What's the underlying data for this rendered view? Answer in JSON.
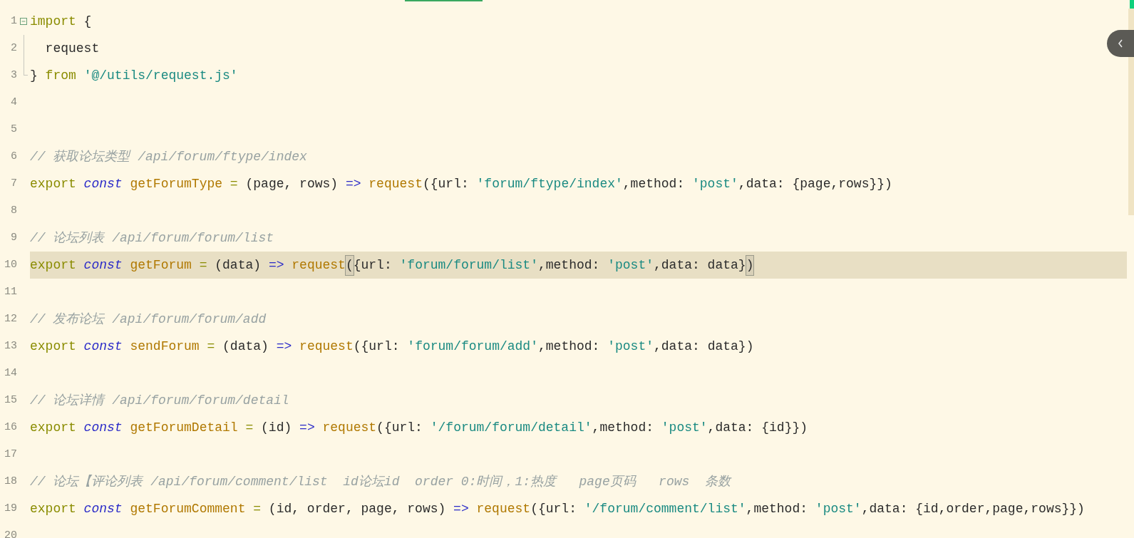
{
  "editor": {
    "lines": [
      {
        "number": "1",
        "kind": "fold_start",
        "current": false,
        "tokens": [
          {
            "kind": "keyword",
            "text": "import"
          },
          {
            "kind": "plain",
            "text": " {"
          }
        ]
      },
      {
        "number": "2",
        "kind": "fold_body",
        "current": false,
        "tokens": [
          {
            "kind": "plain",
            "text": "  request"
          }
        ]
      },
      {
        "number": "3",
        "kind": "fold_end",
        "current": false,
        "tokens": [
          {
            "kind": "plain",
            "text": "}"
          },
          {
            "kind": "keyword",
            "text": " from"
          },
          {
            "kind": "string",
            "text": " '@/utils/request.js'"
          }
        ]
      },
      {
        "number": "4",
        "kind": "code",
        "current": false
      },
      {
        "number": "5",
        "kind": "code",
        "current": false
      },
      {
        "number": "6",
        "kind": "code",
        "current": false,
        "tokens": [
          {
            "kind": "comment",
            "text": "// 获取论坛类型 /api/forum/ftype/index"
          }
        ]
      },
      {
        "number": "7",
        "kind": "code",
        "current": false,
        "tokens": [
          {
            "kind": "keyword",
            "text": "export"
          },
          {
            "kind": "storage",
            "text": " const"
          },
          {
            "kind": "function",
            "text": " getForumType"
          },
          {
            "kind": "keyword",
            "text": " ="
          },
          {
            "kind": "plain",
            "text": " (page, rows)"
          },
          {
            "kind": "arrow",
            "text": " =>"
          },
          {
            "kind": "function",
            "text": " request"
          },
          {
            "kind": "plain",
            "text": "({url: "
          },
          {
            "kind": "string",
            "text": "'forum/ftype/index'"
          },
          {
            "kind": "plain",
            "text": ",method: "
          },
          {
            "kind": "string",
            "text": "'post'"
          },
          {
            "kind": "plain",
            "text": ",data: {page,rows}})"
          }
        ]
      },
      {
        "number": "8",
        "kind": "code",
        "current": false
      },
      {
        "number": "9",
        "kind": "code",
        "current": false,
        "tokens": [
          {
            "kind": "comment",
            "text": "// 论坛列表 /api/forum/forum/list"
          }
        ]
      },
      {
        "number": "10",
        "kind": "code",
        "current": true,
        "tokens": [
          {
            "kind": "keyword",
            "text": "export"
          },
          {
            "kind": "storage",
            "text": " const"
          },
          {
            "kind": "function",
            "text": " getForum"
          },
          {
            "kind": "keyword",
            "text": " ="
          },
          {
            "kind": "plain",
            "text": " (data)"
          },
          {
            "kind": "arrow",
            "text": " =>"
          },
          {
            "kind": "function",
            "text": " request"
          },
          {
            "kind": "bracket_match",
            "text": "("
          },
          {
            "kind": "plain",
            "text": "{url: "
          },
          {
            "kind": "string",
            "text": "'forum/forum/list'"
          },
          {
            "kind": "plain",
            "text": ",method: "
          },
          {
            "kind": "string",
            "text": "'post'"
          },
          {
            "kind": "plain",
            "text": ",data: data}"
          },
          {
            "kind": "bracket_match",
            "text": ")"
          }
        ]
      },
      {
        "number": "11",
        "kind": "code",
        "current": false
      },
      {
        "number": "12",
        "kind": "code",
        "current": false,
        "tokens": [
          {
            "kind": "comment",
            "text": "// 发布论坛 /api/forum/forum/add"
          }
        ]
      },
      {
        "number": "13",
        "kind": "code",
        "current": false,
        "tokens": [
          {
            "kind": "keyword",
            "text": "export"
          },
          {
            "kind": "storage",
            "text": " const"
          },
          {
            "kind": "function",
            "text": " sendForum"
          },
          {
            "kind": "keyword",
            "text": " ="
          },
          {
            "kind": "plain",
            "text": " (data)"
          },
          {
            "kind": "arrow",
            "text": " =>"
          },
          {
            "kind": "function",
            "text": " request"
          },
          {
            "kind": "plain",
            "text": "({url: "
          },
          {
            "kind": "string",
            "text": "'forum/forum/add'"
          },
          {
            "kind": "plain",
            "text": ",method: "
          },
          {
            "kind": "string",
            "text": "'post'"
          },
          {
            "kind": "plain",
            "text": ",data: data})"
          }
        ]
      },
      {
        "number": "14",
        "kind": "code",
        "current": false
      },
      {
        "number": "15",
        "kind": "code",
        "current": false,
        "tokens": [
          {
            "kind": "comment",
            "text": "// 论坛详情 /api/forum/forum/detail"
          }
        ]
      },
      {
        "number": "16",
        "kind": "code",
        "current": false,
        "tokens": [
          {
            "kind": "keyword",
            "text": "export"
          },
          {
            "kind": "storage",
            "text": " const"
          },
          {
            "kind": "function",
            "text": " getForumDetail"
          },
          {
            "kind": "keyword",
            "text": " ="
          },
          {
            "kind": "plain",
            "text": " (id)"
          },
          {
            "kind": "arrow",
            "text": " =>"
          },
          {
            "kind": "function",
            "text": " request"
          },
          {
            "kind": "plain",
            "text": "({url: "
          },
          {
            "kind": "string",
            "text": "'/forum/forum/detail'"
          },
          {
            "kind": "plain",
            "text": ",method: "
          },
          {
            "kind": "string",
            "text": "'post'"
          },
          {
            "kind": "plain",
            "text": ",data: {id}})"
          }
        ]
      },
      {
        "number": "17",
        "kind": "code",
        "current": false
      },
      {
        "number": "18",
        "kind": "code",
        "current": false,
        "tokens": [
          {
            "kind": "comment",
            "text": "// 论坛【评论列表 /api/forum/comment/list  id论坛id  order 0:时间，1:热度   page页码   rows  条数"
          }
        ]
      },
      {
        "number": "19",
        "kind": "code",
        "current": false,
        "tokens": [
          {
            "kind": "keyword",
            "text": "export"
          },
          {
            "kind": "storage",
            "text": " const"
          },
          {
            "kind": "function",
            "text": " getForumComment"
          },
          {
            "kind": "keyword",
            "text": " ="
          },
          {
            "kind": "plain",
            "text": " (id, order, page, rows)"
          },
          {
            "kind": "arrow",
            "text": " =>"
          },
          {
            "kind": "function",
            "text": " request"
          },
          {
            "kind": "plain",
            "text": "({url: "
          },
          {
            "kind": "string",
            "text": "'/forum/comment/list'"
          },
          {
            "kind": "plain",
            "text": ",method: "
          },
          {
            "kind": "string",
            "text": "'post'"
          },
          {
            "kind": "plain",
            "text": ",data: {id,order,page,rows}})"
          }
        ]
      },
      {
        "number": "20",
        "kind": "code",
        "current": false
      }
    ]
  }
}
